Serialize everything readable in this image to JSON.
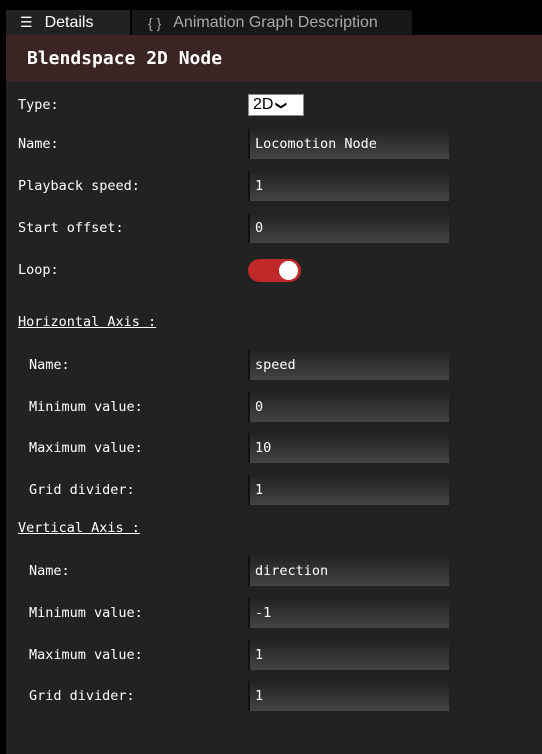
{
  "tabs": [
    {
      "label": "Details",
      "icon": "list-icon",
      "active": true
    },
    {
      "label": "Animation Graph Description",
      "icon": "braces-icon",
      "active": false
    }
  ],
  "header": {
    "title": "Blendspace 2D Node"
  },
  "fields": {
    "type": {
      "label": "Type:",
      "value": "2D"
    },
    "name": {
      "label": "Name:",
      "value": "Locomotion Node"
    },
    "playback": {
      "label": "Playback speed:",
      "value": "1"
    },
    "start": {
      "label": "Start offset:",
      "value": "0"
    },
    "loop": {
      "label": "Loop:",
      "on": true,
      "color": "#c0282a"
    }
  },
  "horizontal": {
    "title": "Horizontal Axis :",
    "name": {
      "label": "Name:",
      "value": "speed"
    },
    "min": {
      "label": "Minimum value:",
      "value": "0"
    },
    "max": {
      "label": "Maximum value:",
      "value": "10"
    },
    "grid": {
      "label": "Grid divider:",
      "value": "1"
    }
  },
  "vertical": {
    "title": "Vertical Axis :",
    "name": {
      "label": "Name:",
      "value": "direction"
    },
    "min": {
      "label": "Minimum value:",
      "value": "-1"
    },
    "max": {
      "label": "Maximum value:",
      "value": "1"
    },
    "grid": {
      "label": "Grid divider:",
      "value": "1"
    }
  }
}
